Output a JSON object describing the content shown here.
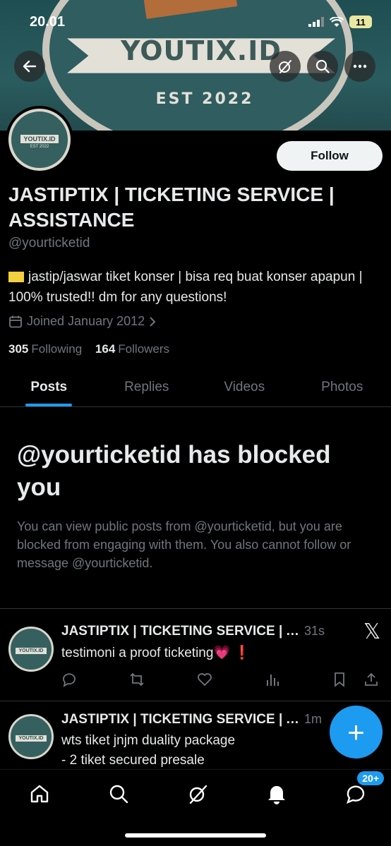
{
  "status_bar": {
    "time": "20.01",
    "battery": "11"
  },
  "banner": {
    "logo_text": "YOUTIX.ID",
    "est_text": "EST 2022"
  },
  "avatar": {
    "ribbon_text": "YOUTIX.ID",
    "est_text": "EST 2022"
  },
  "profile": {
    "follow_label": "Follow",
    "name": "JASTIPTIX | TICKETING SERVICE | ASSISTANCE",
    "handle": "@yourticketid",
    "bio": "jastip/jaswar tiket konser | bisa req buat konser apapun | 100% trusted!! dm for any questions!",
    "joined": "Joined January 2012",
    "following_count": "305",
    "following_label": "Following",
    "followers_count": "164",
    "followers_label": "Followers"
  },
  "tabs": [
    {
      "label": "Posts",
      "active": true
    },
    {
      "label": "Replies",
      "active": false
    },
    {
      "label": "Videos",
      "active": false
    },
    {
      "label": "Photos",
      "active": false
    }
  ],
  "blocked": {
    "title": "@yourticketid has blocked you",
    "text": "You can view public posts from @yourticketid, but you are blocked from engaging with them. You also cannot follow or message @yourticketid."
  },
  "posts": [
    {
      "author": "JASTIPTIX | TICKETING SERVICE | ASSISTANCE",
      "time": "31s",
      "text": "testimoni a proof ticketing💗 ❗",
      "text_line2": ""
    },
    {
      "author": "JASTIPTIX | TICKETING SERVICE | ASSISTANCE",
      "time": "1m",
      "text": "wts tiket jnjm duality package",
      "text_line2": "- 2 tiket secured presale"
    }
  ],
  "fab_label": "+",
  "nav": {
    "messages_badge": "20+"
  },
  "colors": {
    "accent": "#1d9bf0",
    "background": "#000000",
    "muted": "#71767b"
  }
}
